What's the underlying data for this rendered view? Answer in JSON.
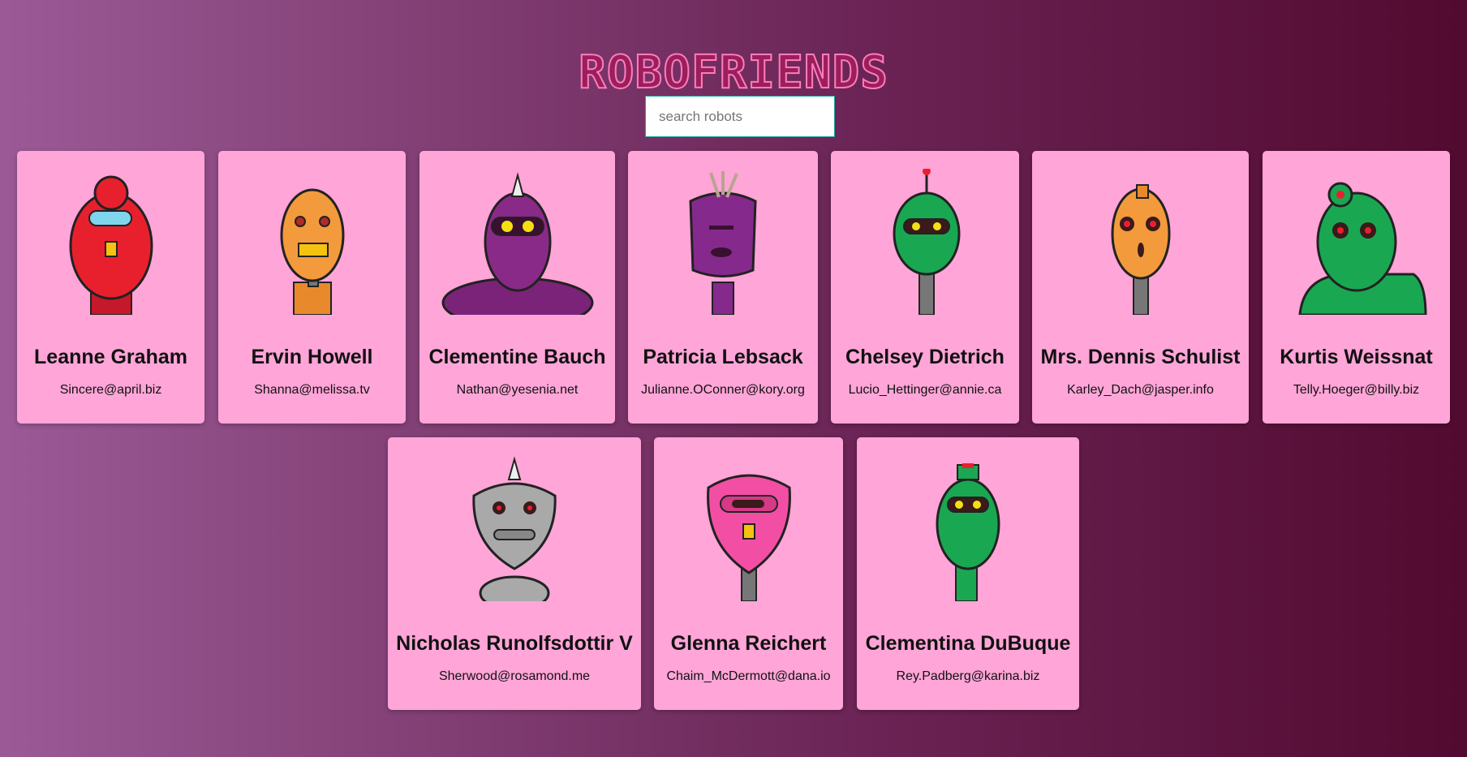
{
  "app": {
    "title": "ROBOFRIENDS"
  },
  "search": {
    "placeholder": "search robots",
    "value": ""
  },
  "robots": [
    {
      "name": "Leanne Graham",
      "email": "Sincere@april.biz",
      "color": "#e8202e"
    },
    {
      "name": "Ervin Howell",
      "email": "Shanna@melissa.tv",
      "color": "#f39a3c"
    },
    {
      "name": "Clementine Bauch",
      "email": "Nathan@yesenia.net",
      "color": "#8a2a88"
    },
    {
      "name": "Patricia Lebsack",
      "email": "Julianne.OConner@kory.org",
      "color": "#852a8c"
    },
    {
      "name": "Chelsey Dietrich",
      "email": "Lucio_Hettinger@annie.ca",
      "color": "#1aa752"
    },
    {
      "name": "Mrs. Dennis Schulist",
      "email": "Karley_Dach@jasper.info",
      "color": "#f39a3c"
    },
    {
      "name": "Kurtis Weissnat",
      "email": "Telly.Hoeger@billy.biz",
      "color": "#1aa752"
    },
    {
      "name": "Nicholas Runolfsdottir V",
      "email": "Sherwood@rosamond.me",
      "color": "#a9a9a9"
    },
    {
      "name": "Glenna Reichert",
      "email": "Chaim_McDermott@dana.io",
      "color": "#f24fa4"
    },
    {
      "name": "Clementina DuBuque",
      "email": "Rey.Padberg@karina.biz",
      "color": "#1aa752"
    }
  ]
}
